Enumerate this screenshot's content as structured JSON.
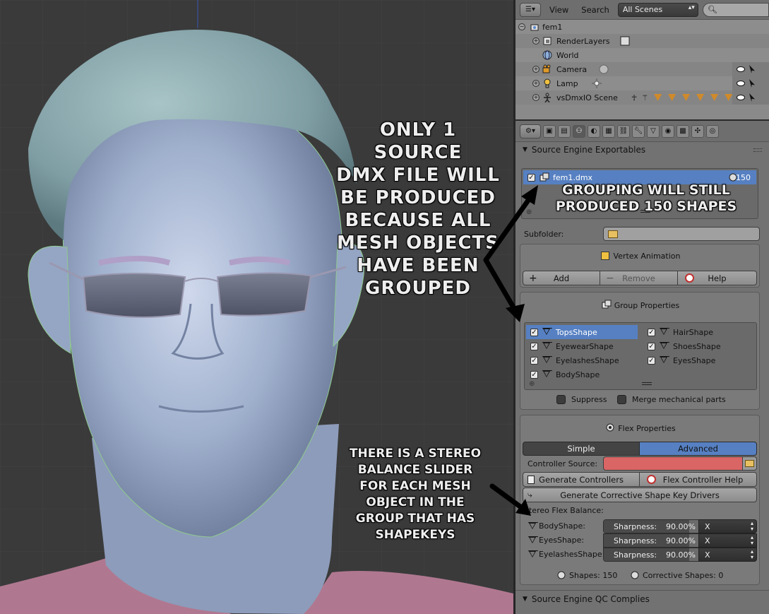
{
  "annotations": {
    "single_file": [
      "ONLY 1 SOURCE",
      "DMX FILE WILL",
      "BE PRODUCED",
      "BECAUSE ALL",
      "MESH OBJECTS",
      "HAVE BEEN",
      "GROUPED"
    ],
    "grouping": [
      "GROUPING WILL STILL",
      "PRODUCED 150 SHAPES"
    ],
    "stereo": [
      "THERE IS A STEREO",
      "BALANCE SLIDER",
      "FOR EACH MESH",
      "OBJECT IN THE",
      "GROUP THAT HAS",
      "SHAPEKEYS"
    ]
  },
  "outliner": {
    "menu_view": "View",
    "menu_search": "Search",
    "scene_filter": "All Scenes",
    "items": [
      {
        "label": "fem1",
        "icon": "scene-icon"
      },
      {
        "label": "RenderLayers",
        "icon": "renderlayers-icon"
      },
      {
        "label": "World",
        "icon": "world-icon"
      },
      {
        "label": "Camera",
        "icon": "camera-icon"
      },
      {
        "label": "Lamp",
        "icon": "lamp-icon"
      },
      {
        "label": "vsDmxIO Scene",
        "icon": "armature-icon"
      }
    ]
  },
  "exportables": {
    "panel_title": "Source Engine Exportables",
    "item_label": "fem1.dmx",
    "item_count": "150",
    "subfolder_label": "Subfolder:"
  },
  "vertex_animation": {
    "title": "Vertex Animation",
    "add": "Add",
    "remove": "Remove",
    "help": "Help"
  },
  "group_properties": {
    "title": "Group Properties",
    "left_items": [
      "TopsShape",
      "EyewearShape",
      "EyelashesShape",
      "BodyShape"
    ],
    "right_items": [
      "HairShape",
      "ShoesShape",
      "EyesShape"
    ],
    "suppress": "Suppress",
    "merge": "Merge mechanical parts"
  },
  "flex_properties": {
    "title": "Flex Properties",
    "tab_simple": "Simple",
    "tab_advanced": "Advanced",
    "controller_source": "Controller Source:",
    "generate_controllers": "Generate Controllers",
    "flex_help": "Flex Controller Help",
    "generate_drivers": "Generate Corrective Shape Key Drivers",
    "stereo_label": "Stereo Flex Balance:",
    "balance_rows": [
      {
        "name": "BodyShape:",
        "sharpness_label": "Sharpness:",
        "value": "90.00%",
        "axis": "X"
      },
      {
        "name": "EyesShape:",
        "sharpness_label": "Sharpness:",
        "value": "90.00%",
        "axis": "X"
      },
      {
        "name": "EyelashesShape:",
        "sharpness_label": "Sharpness:",
        "value": "90.00%",
        "axis": "X"
      }
    ],
    "sharpness_fraction": 0.9,
    "shapes": "Shapes: 150",
    "corrective": "Corrective Shapes: 0"
  },
  "qc_panel_title": "Source Engine QC Complies",
  "colors": {
    "selection": "#5680c2",
    "controller_source_field": "#d96565",
    "viewport_bg": "#3a3a3a"
  }
}
